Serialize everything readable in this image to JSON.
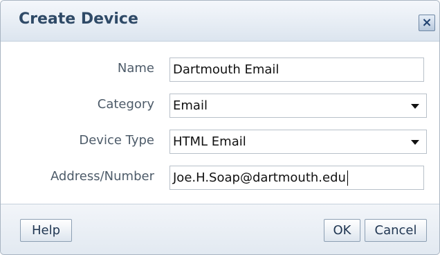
{
  "dialog": {
    "title": "Create Device",
    "close_icon": "close-icon"
  },
  "form": {
    "name": {
      "label": "Name",
      "value": "Dartmouth Email"
    },
    "category": {
      "label": "Category",
      "value": "Email"
    },
    "device_type": {
      "label": "Device Type",
      "value": "HTML Email"
    },
    "address": {
      "label": "Address/Number",
      "value": "Joe.H.Soap@dartmouth.edu"
    }
  },
  "buttons": {
    "help": "Help",
    "ok": "OK",
    "cancel": "Cancel"
  },
  "colors": {
    "title_text": "#2f4a67",
    "label_text": "#4d5b69",
    "border": "#b8c0c9",
    "header_bg": "#dce5ef",
    "footer_bg": "#e2e9f1"
  }
}
